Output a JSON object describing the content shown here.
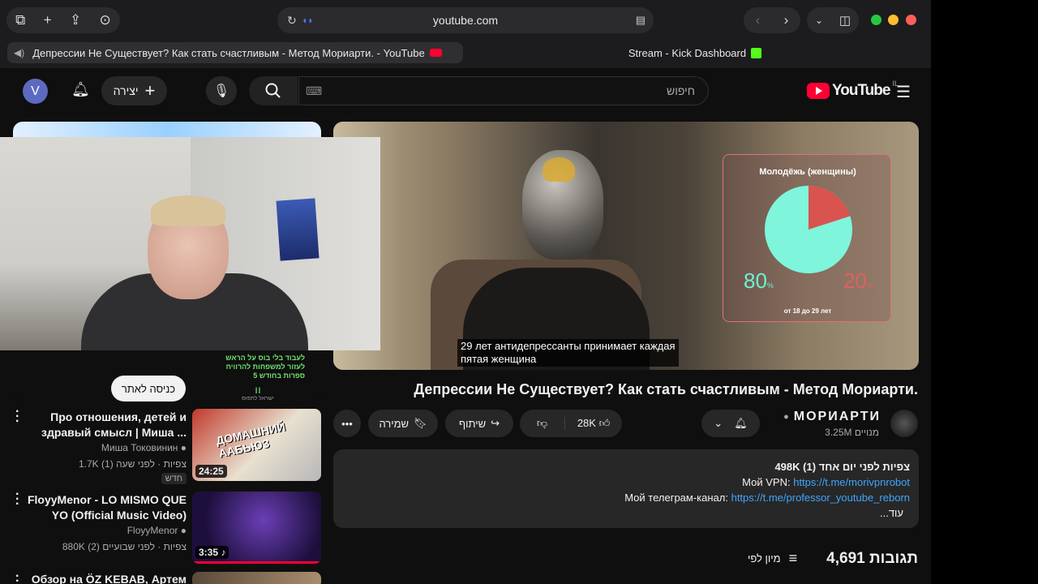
{
  "browser": {
    "address": "youtube.com",
    "tabs": [
      {
        "label": "Депрессии Не Существует? Как стать счастливым - Метод Мориарти. - YouTube"
      },
      {
        "label": "Stream - Kick Dashboard"
      }
    ]
  },
  "header": {
    "avatar_letter": "V",
    "create_label": "יצירה",
    "search_placeholder": "חיפוש",
    "logo_text": "YouTube",
    "region": "IL"
  },
  "video": {
    "subtitle_line1": "29 лет антидепрессанты принимает каждая",
    "subtitle_line2": "пятая женщина",
    "overlay_title": "Молодёжь (женщины)",
    "overlay_pct_left": "80",
    "overlay_pct_right": "20",
    "overlay_caption": "от 18 до 29 лет",
    "pie_share": 0.2,
    "title": "Депрессии Не Существует? Как стать счастливым - Метод Мориарти."
  },
  "channel": {
    "name": "МОРИАРТИ",
    "subscribers": "3.25M מנויים"
  },
  "actions": {
    "likes": "28K",
    "share": "שיתוף",
    "save": "שמירה"
  },
  "description": {
    "stats": "498K צפיות  לפני יום אחד (1)",
    "line1_label": "Мой VPN: ",
    "line1_link": "https://t.me/morivpnrobot",
    "line2_label": "Мой телеграм-канал: ",
    "line2_link": "https://t.me/professor_youtube_reborn",
    "more": "...עוד"
  },
  "comments": {
    "count": "4,691 תגובות",
    "sort": "מיון לפי"
  },
  "ad": {
    "line1": "לעבוד בלי בוס על הראש",
    "line2": "לעזור למשפחות להרוויח",
    "line3": "5 ספרות בחודש",
    "brand": "ישראל לתפוס",
    "button": "כניסה לאתר"
  },
  "sidebar": [
    {
      "title_1": "Про отношения, детей и",
      "title_2": "здравый смысл | Миша ...",
      "channel": "Миша Токовинин",
      "meta": "1.7K צפיות · לפני שעה (1)",
      "badge": "חדש",
      "duration": "24:25",
      "thumb_text": "ДОМАШНИЙ ААБЬЮЗ"
    },
    {
      "title_1": "FloyyMenor - LO MISMO QUE",
      "title_2": "YO (Official Music Video)",
      "channel": "FloyyMenor",
      "meta": "880K צפיות · לפני שבועיים (2)",
      "badge": "",
      "duration": "3:35",
      "thumb_text": ""
    },
    {
      "title_1": "Обзор на ÖZ KEBAB, Артем",
      "title_2": "",
      "channel": "",
      "meta": "",
      "badge": "",
      "duration": "",
      "thumb_text": ""
    }
  ]
}
